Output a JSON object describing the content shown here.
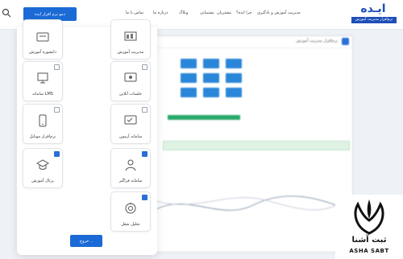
{
  "navbar": {
    "cta_label": "دمو نرم افزار ایده",
    "links": [
      "درباره ما",
      "تماس با ما",
      "مقالات",
      "پشتیبانی",
      "چرا ایده؟",
      "مشتریان",
      "وبلاگ",
      "مدیریت آموزش و یادگیری"
    ]
  },
  "logo": {
    "wordmark": "ایـده",
    "tagline": "نرم‌افزار مدیریت آموزش"
  },
  "background_window": {
    "title": "نرم‌افزار مدیریت آموزش"
  },
  "modules": [
    {
      "label": "دانشوره آموزش",
      "checked": false,
      "icon": "graduation-icon"
    },
    {
      "label": "مدیریت آموزش",
      "checked": false,
      "icon": "dashboard-icon"
    },
    {
      "label": "سامانه LMS",
      "checked": false,
      "icon": "lms-icon"
    },
    {
      "label": "جلسات آنلاین",
      "checked": false,
      "icon": "meeting-icon"
    },
    {
      "label": "نرم‌افزار موبایل",
      "checked": false,
      "icon": "mobile-icon"
    },
    {
      "label": "سامانه آزمون",
      "checked": false,
      "icon": "exam-icon"
    },
    {
      "label": "پرتال آموزش",
      "checked": true,
      "icon": "portal-icon"
    },
    {
      "label": "سامانه فراگیر",
      "checked": true,
      "icon": "learner-icon"
    },
    {
      "label": "تحلیل شغل",
      "checked": true,
      "icon": "job-analysis-icon"
    }
  ],
  "exit_label": "خروج ..",
  "brand": {
    "name": "ثبت آشنا",
    "latin": "ASHA SABT"
  }
}
